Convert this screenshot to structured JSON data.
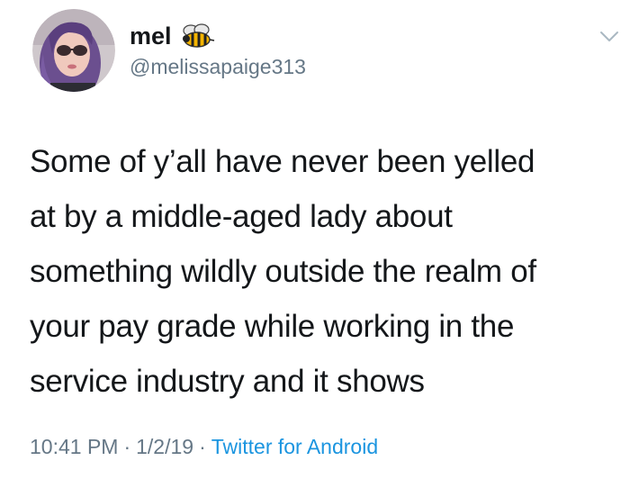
{
  "tweet": {
    "display_name": "mel",
    "name_emoji": "bee-icon",
    "handle": "@melissapaige313",
    "text": "Some of y’all have never been yelled\nat by a middle-aged lady about\nsomething wildly outside the realm of\nyour pay grade while working in the\nservice industry and it shows",
    "time": "10:41 PM",
    "separator": "·",
    "date": "1/2/19",
    "source": "Twitter for Android"
  },
  "colors": {
    "text": "#14171a",
    "secondary": "#657786",
    "link": "#1b95e0",
    "background": "#ffffff"
  },
  "icons": [
    "avatar",
    "bee-icon",
    "chevron-down-icon"
  ]
}
